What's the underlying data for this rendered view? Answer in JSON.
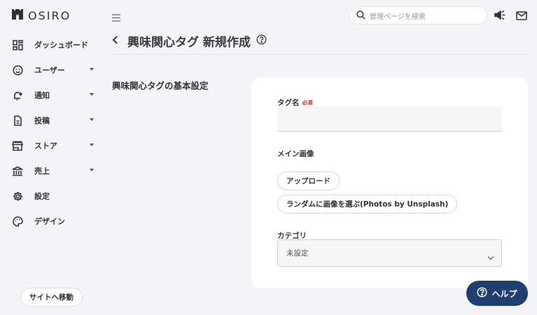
{
  "app": {
    "logo_text": "OSIRO"
  },
  "sidebar": {
    "items": [
      {
        "label": "ダッシュボード",
        "icon": "dashboard-icon",
        "has_submenu": false
      },
      {
        "label": "ユーザー",
        "icon": "user-icon",
        "has_submenu": true
      },
      {
        "label": "通知",
        "icon": "bell-icon",
        "has_submenu": true
      },
      {
        "label": "投稿",
        "icon": "document-icon",
        "has_submenu": true
      },
      {
        "label": "ストア",
        "icon": "store-icon",
        "has_submenu": true
      },
      {
        "label": "売上",
        "icon": "bank-icon",
        "has_submenu": true
      },
      {
        "label": "設定",
        "icon": "gear-icon",
        "has_submenu": false
      },
      {
        "label": "デザイン",
        "icon": "palette-icon",
        "has_submenu": false
      }
    ],
    "site_link_label": "サイトへ移動"
  },
  "header": {
    "search_placeholder": "管理ページを検索",
    "icons": [
      "menu-icon",
      "search-icon",
      "announcement-icon",
      "mail-icon"
    ]
  },
  "page": {
    "title": "興味関心タグ 新規作成",
    "section_title": "興味関心タグの基本設定"
  },
  "form": {
    "tag_name_label": "タグ名",
    "required_badge": "必須",
    "tag_name_value": "",
    "main_image_label": "メイン画像",
    "upload_button": "アップロード",
    "random_image_button": "ランダムに画像を選ぶ(Photos by Unsplash)",
    "category_label": "カテゴリ",
    "category_value": "未設定"
  },
  "help": {
    "label": "ヘルプ"
  },
  "colors": {
    "accent": "#1f3f6e",
    "required": "#e02c2c",
    "background": "#f3f4f7",
    "card": "#ffffff"
  }
}
